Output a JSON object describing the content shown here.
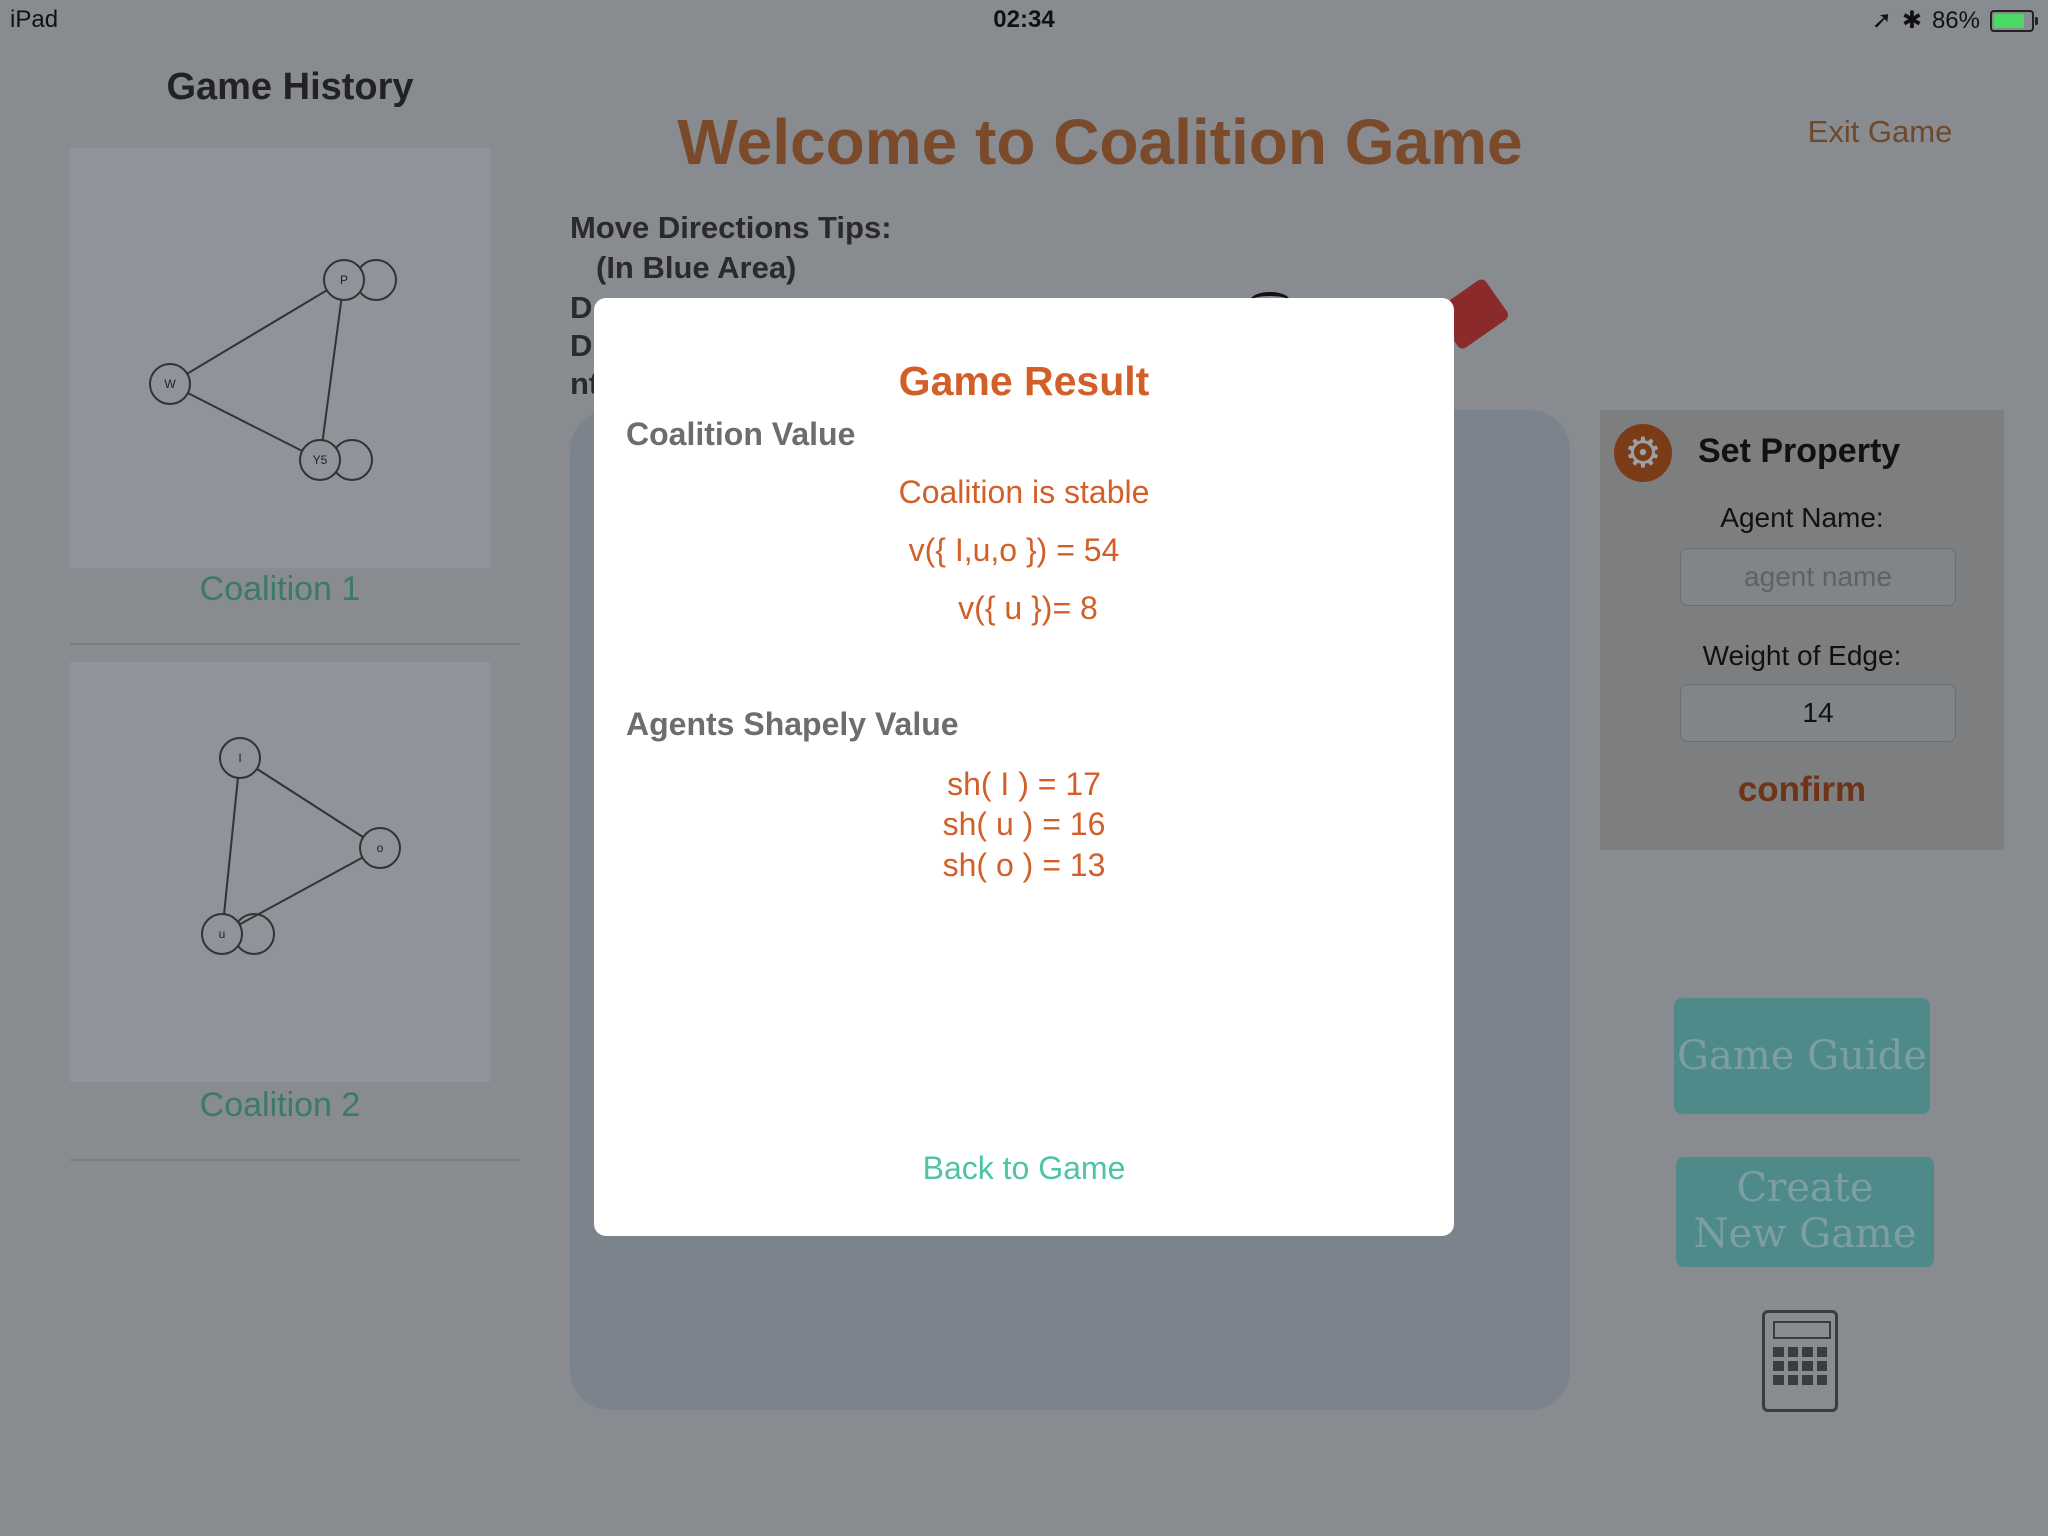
{
  "status_bar": {
    "device": "iPad",
    "time": "02:34",
    "battery": "86%",
    "battery_level": 0.86
  },
  "sidebar": {
    "title": "Game History",
    "coalitions": [
      {
        "label": "Coalition 1",
        "nodes": [
          "P",
          "W",
          "Y5"
        ]
      },
      {
        "label": "Coalition 2",
        "nodes": [
          "I",
          "o",
          "u"
        ]
      }
    ]
  },
  "header": {
    "title": "Welcome to Coalition Game",
    "exit": "Exit Game"
  },
  "tips": {
    "title": "Move Directions Tips:",
    "subtitle": "(In Blue Area)",
    "line1": "D",
    "line2": "D",
    "line3": "nt"
  },
  "property": {
    "title": "Set Property",
    "agent_label": "Agent Name:",
    "agent_placeholder": "agent name",
    "weight_label": "Weight of Edge:",
    "weight_value": "14",
    "confirm": "confirm"
  },
  "buttons": {
    "guide": "Game Guide",
    "create_line1": "Create",
    "create_line2": "New Game"
  },
  "modal": {
    "title": "Game Result",
    "coalition_heading": "Coalition Value",
    "stable": "Coalition is stable",
    "v_all": "v({ I,u,o }) = 54",
    "v_u": "v({ u })= 8",
    "shapley_heading": "Agents Shapely Value",
    "sh_I": "sh( I ) = 17",
    "sh_u": "sh( u ) = 16",
    "sh_o": "sh( o ) = 13",
    "back": "Back to Game"
  },
  "colors": {
    "accent": "#d35f28",
    "back_link": "#4ec3a8",
    "coalition_label": "#3a7a66"
  }
}
